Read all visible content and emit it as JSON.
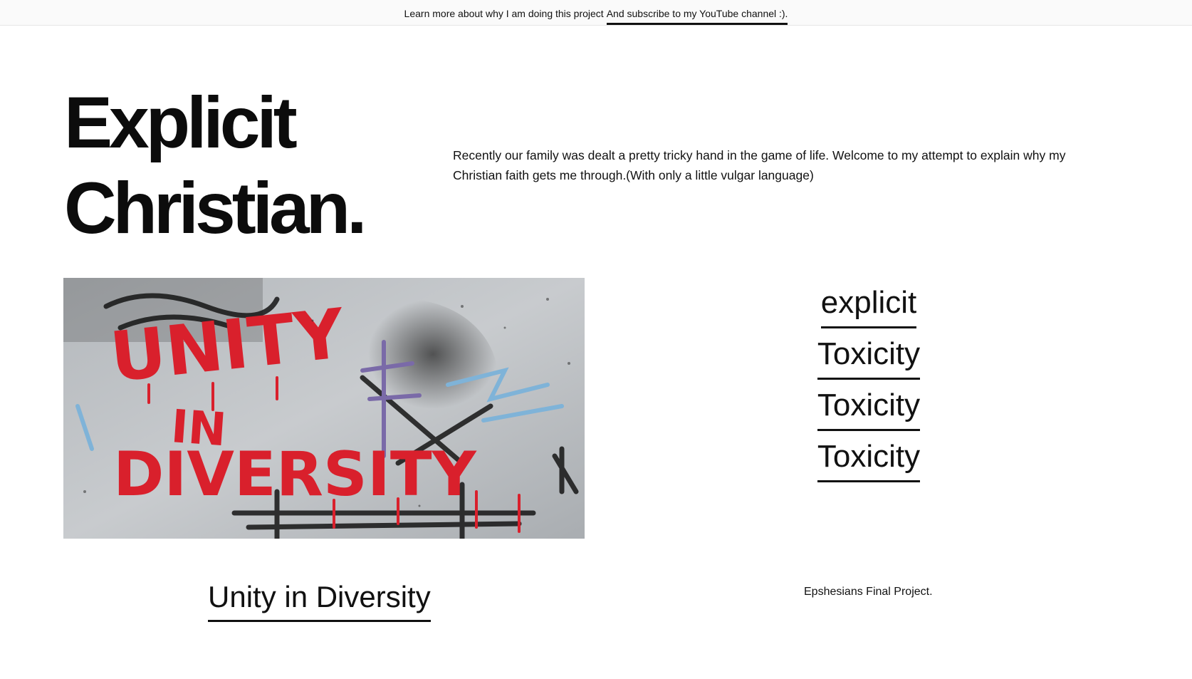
{
  "announcement": {
    "text": "Learn more about why I am doing this project",
    "link_label": "And subscribe to my YouTube channel :)."
  },
  "hero": {
    "title_line1": "Explicit",
    "title_line2": "Christian.",
    "intro": "Recently our family was dealt a pretty tricky hand in the game of life. Welcome to my attempt to explain why my Christian faith gets me through.(With only a little vulgar language)"
  },
  "image": {
    "graffiti_text_1": "UNITY",
    "graffiti_text_2": "IN",
    "graffiti_text_3": "DIVERSITY",
    "caption_link": "Unity in Diversity"
  },
  "links": [
    {
      "label": "explicit"
    },
    {
      "label": "Toxicity"
    },
    {
      "label": "Toxicity"
    },
    {
      "label": "Toxicity"
    }
  ],
  "footer": {
    "note": "Epshesians Final Project."
  },
  "colors": {
    "text": "#111111",
    "graffiti_red": "#d9202c",
    "wall": "#bfc2c5"
  }
}
